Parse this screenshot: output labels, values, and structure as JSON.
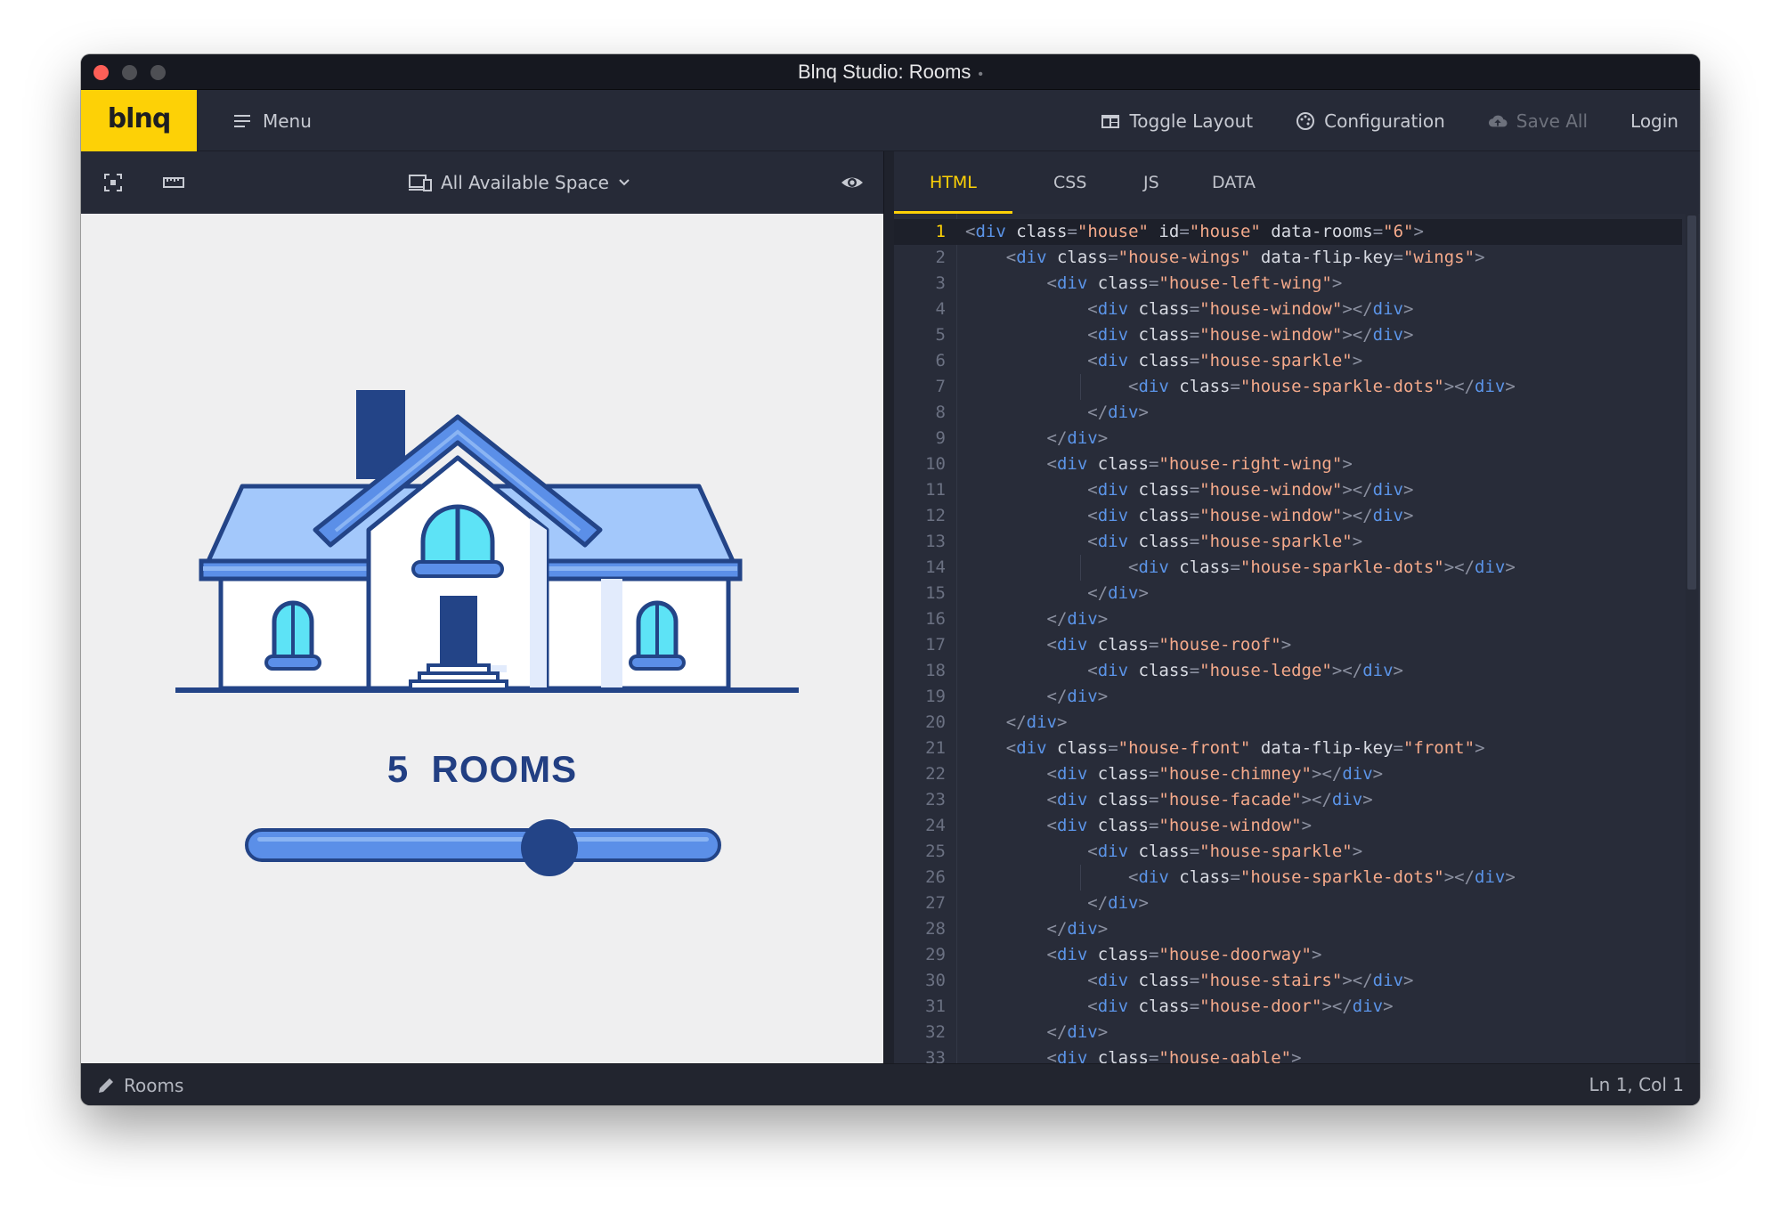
{
  "window": {
    "title": "Blnq Studio: Rooms",
    "modified_indicator": "•"
  },
  "header": {
    "logo": "blnq",
    "menu_label": "Menu",
    "toggle_layout_label": "Toggle Layout",
    "configuration_label": "Configuration",
    "save_all_label": "Save All",
    "login_label": "Login"
  },
  "preview_toolbar": {
    "device_label": "All Available Space"
  },
  "preview": {
    "rooms_count": "5",
    "rooms_word": "ROOMS",
    "slider_fraction": 0.65,
    "colors": {
      "outline": "#234487",
      "roof": "#a3c8fb",
      "roof_band": "#5b8fe8",
      "window_glass": "#5de3f6",
      "wall": "#ffffff"
    }
  },
  "editor": {
    "tabs": [
      "HTML",
      "CSS",
      "JS",
      "DATA"
    ],
    "active_tab": "HTML",
    "lines": [
      "<div class=\"house\" id=\"house\" data-rooms=\"6\">",
      "    <div class=\"house-wings\" data-flip-key=\"wings\">",
      "        <div class=\"house-left-wing\">",
      "            <div class=\"house-window\"></div>",
      "            <div class=\"house-window\"></div>",
      "            <div class=\"house-sparkle\">",
      "                <div class=\"house-sparkle-dots\"></div>",
      "            </div>",
      "        </div>",
      "        <div class=\"house-right-wing\">",
      "            <div class=\"house-window\"></div>",
      "            <div class=\"house-window\"></div>",
      "            <div class=\"house-sparkle\">",
      "                <div class=\"house-sparkle-dots\"></div>",
      "            </div>",
      "        </div>",
      "        <div class=\"house-roof\">",
      "            <div class=\"house-ledge\"></div>",
      "        </div>",
      "    </div>",
      "    <div class=\"house-front\" data-flip-key=\"front\">",
      "        <div class=\"house-chimney\"></div>",
      "        <div class=\"house-facade\"></div>",
      "        <div class=\"house-window\">",
      "            <div class=\"house-sparkle\">",
      "                <div class=\"house-sparkle-dots\"></div>",
      "            </div>",
      "        </div>",
      "        <div class=\"house-doorway\">",
      "            <div class=\"house-stairs\"></div>",
      "            <div class=\"house-door\"></div>",
      "        </div>",
      "        <div class=\"house-gable\">"
    ]
  },
  "status": {
    "file_label": "Rooms",
    "cursor_position": "Ln 1, Col 1"
  }
}
